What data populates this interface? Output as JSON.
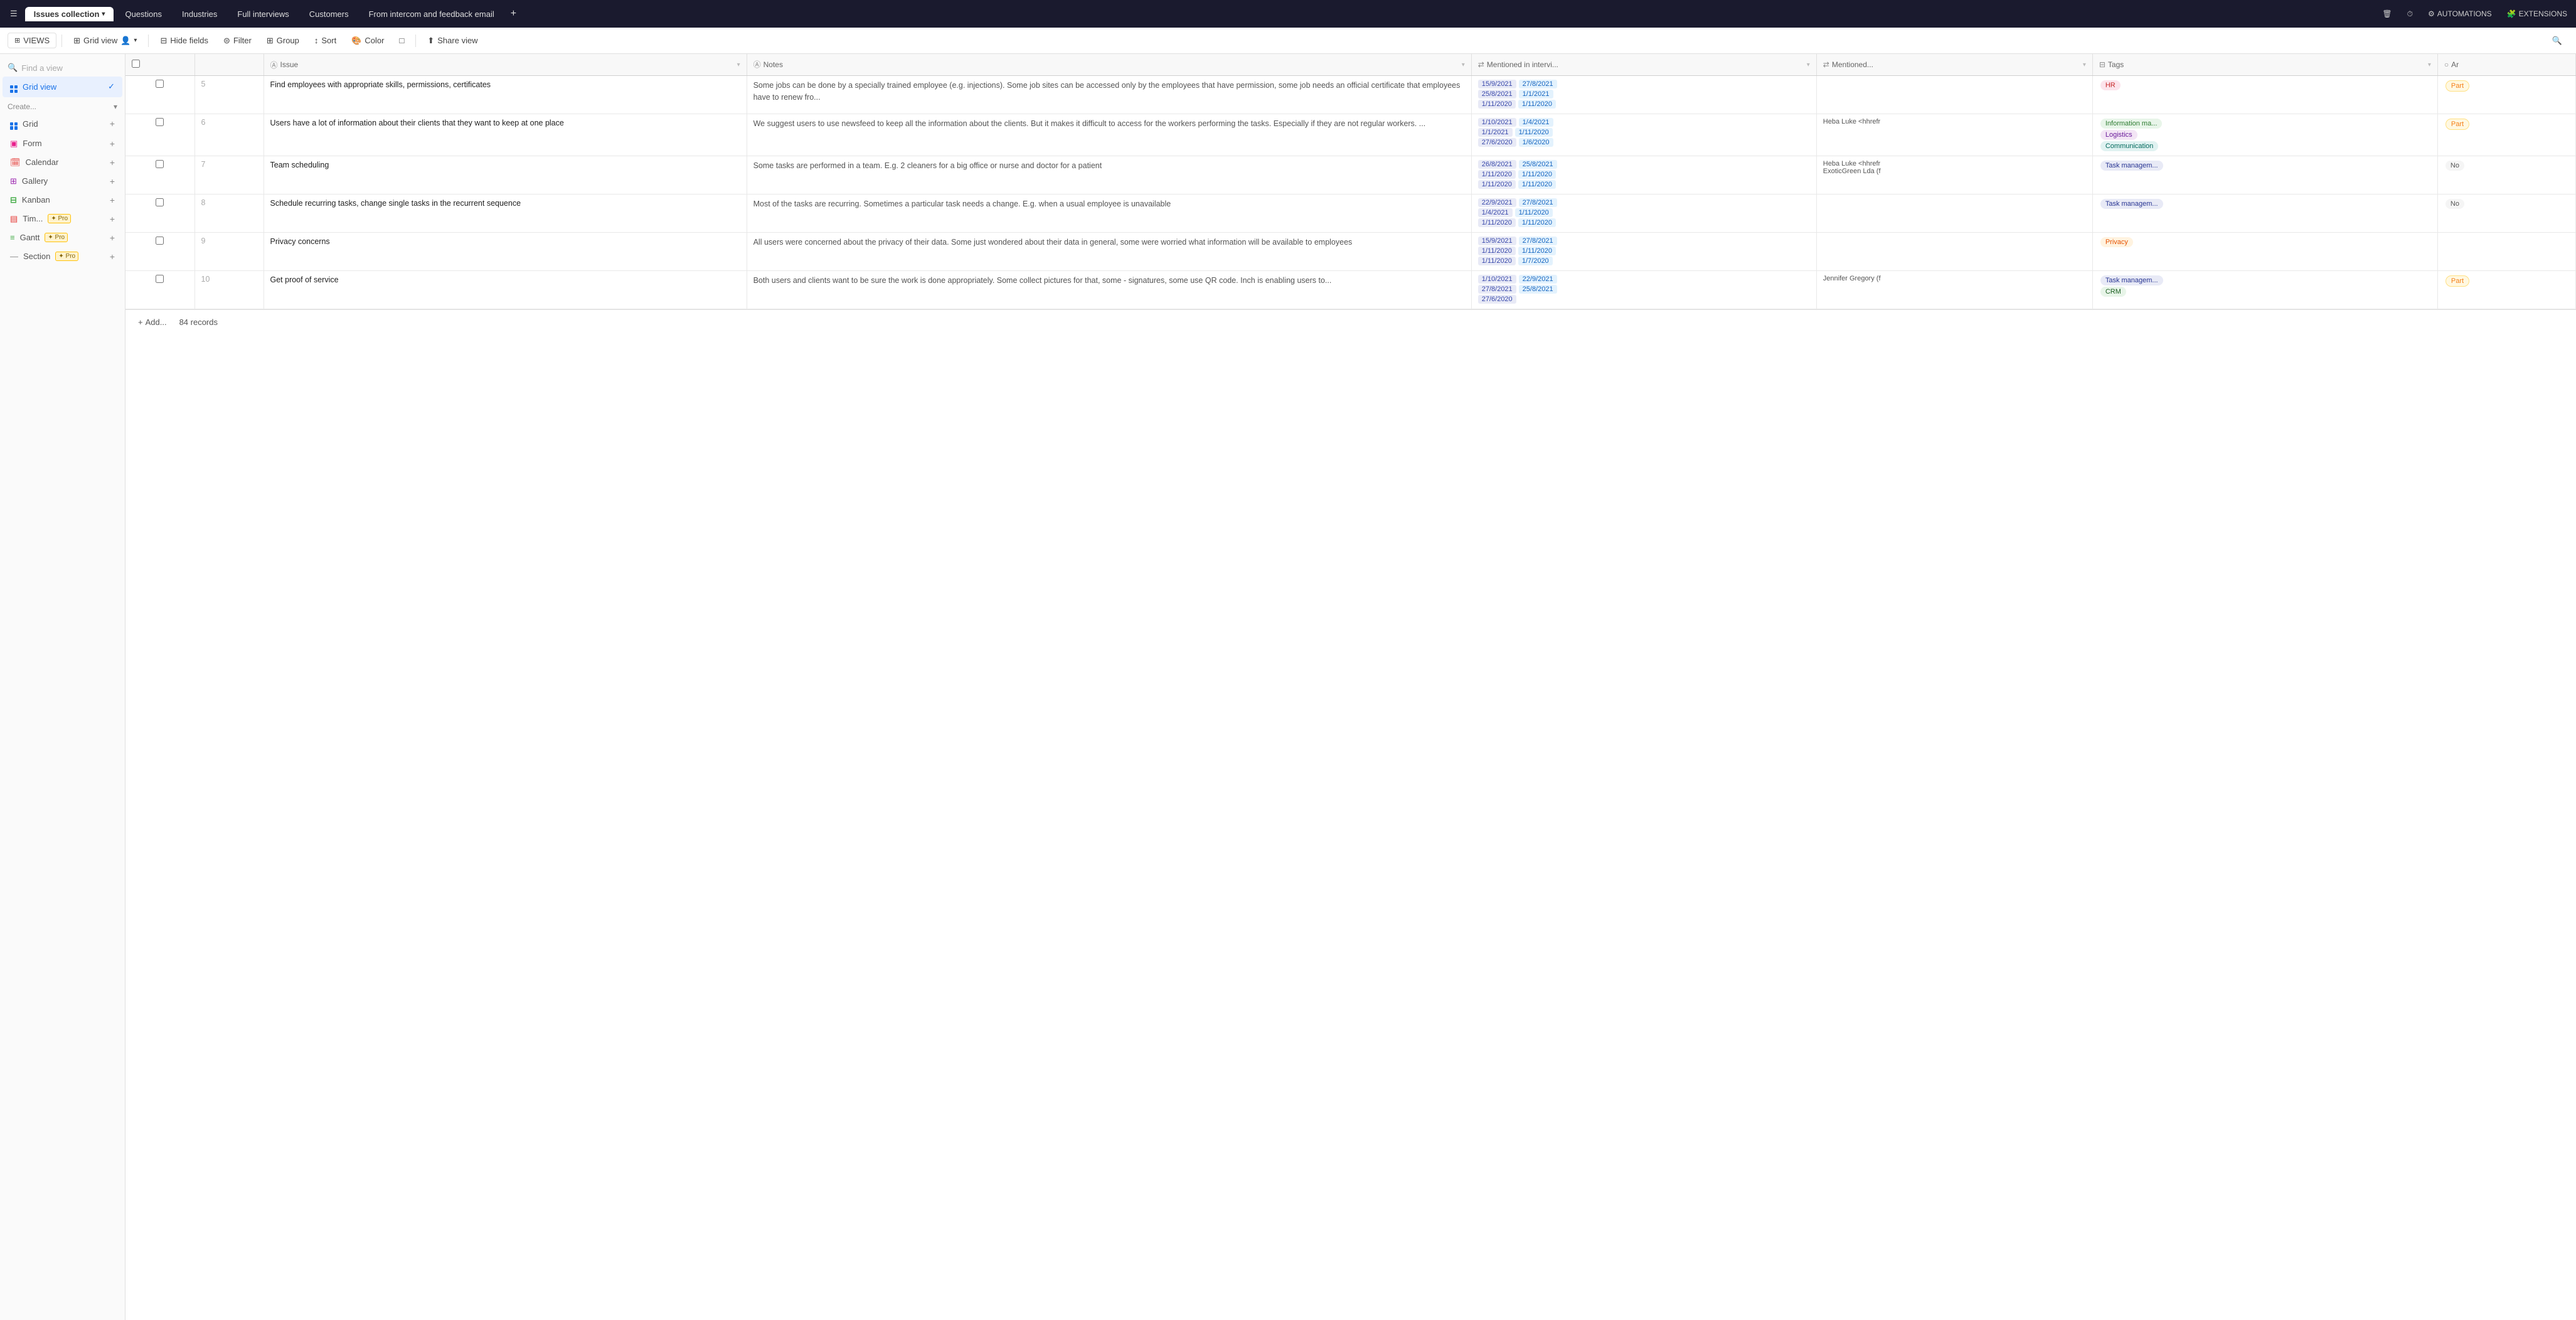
{
  "topNav": {
    "hamburger": "☰",
    "activeTab": "Issues collection",
    "tabs": [
      {
        "id": "issues",
        "label": "Issues collection",
        "active": true,
        "hasDropdown": true
      },
      {
        "id": "questions",
        "label": "Questions",
        "active": false
      },
      {
        "id": "industries",
        "label": "Industries",
        "active": false
      },
      {
        "id": "fullInterviews",
        "label": "Full interviews",
        "active": false
      },
      {
        "id": "customers",
        "label": "Customers",
        "active": false
      },
      {
        "id": "fromIntercom",
        "label": "From intercom and feedback email",
        "active": false
      }
    ],
    "addTabIcon": "+",
    "actions": [
      {
        "id": "trash",
        "icon": "🗑",
        "label": ""
      },
      {
        "id": "history",
        "icon": "⏱",
        "label": ""
      },
      {
        "id": "automations",
        "icon": "⚙",
        "label": "AUTOMATIONS"
      },
      {
        "id": "extensions",
        "icon": "🧩",
        "label": "EXTENSIONS"
      }
    ]
  },
  "toolbar": {
    "views": "VIEWS",
    "gridView": "Grid view",
    "hideFields": "Hide fields",
    "filter": "Filter",
    "group": "Group",
    "sort": "Sort",
    "color": "Color",
    "shareView": "Share view",
    "searchIcon": "🔍"
  },
  "sidebar": {
    "searchPlaceholder": "Find a view",
    "views": [
      {
        "id": "grid",
        "label": "Grid view",
        "active": true,
        "icon": "grid"
      }
    ],
    "createLabel": "Create...",
    "createItems": [
      {
        "id": "grid",
        "label": "Grid",
        "icon": "grid",
        "pro": false
      },
      {
        "id": "form",
        "label": "Form",
        "icon": "form",
        "pro": false
      },
      {
        "id": "calendar",
        "label": "Calendar",
        "icon": "calendar",
        "pro": false
      },
      {
        "id": "gallery",
        "label": "Gallery",
        "icon": "gallery",
        "pro": false
      },
      {
        "id": "kanban",
        "label": "Kanban",
        "icon": "kanban",
        "pro": false
      },
      {
        "id": "timeline",
        "label": "Tim...",
        "icon": "timeline",
        "pro": true
      },
      {
        "id": "gantt",
        "label": "Gantt",
        "icon": "gantt",
        "pro": true
      },
      {
        "id": "section",
        "label": "Section",
        "icon": "section",
        "pro": true
      }
    ]
  },
  "table": {
    "columns": [
      {
        "id": "checkbox",
        "label": "",
        "icon": "checkbox"
      },
      {
        "id": "issue",
        "label": "Issue",
        "icon": "text"
      },
      {
        "id": "notes",
        "label": "Notes",
        "icon": "text"
      },
      {
        "id": "mentioned1",
        "label": "Mentioned in intervi...",
        "icon": "link"
      },
      {
        "id": "mentioned2",
        "label": "Mentioned...",
        "icon": "link"
      },
      {
        "id": "tags",
        "label": "Tags",
        "icon": "tag"
      },
      {
        "id": "ar",
        "label": "Ar",
        "icon": "circle"
      }
    ],
    "rows": [
      {
        "id": 5,
        "issue": "Find employees with appropriate skills, permissions, certificates",
        "notes": "Some jobs can be done by a specially trained employee (e.g. injections). Some job sites can be accessed only by the employees that have permission, some job needs an official certificate that employees have to renew fro...",
        "mentioned1Dates": [
          [
            "15/9/2021",
            "27/8/2021"
          ],
          [
            "25/8/2021",
            "1/1/2021"
          ],
          [
            "1/11/2020",
            "1/11/2020"
          ]
        ],
        "mentioned2": [],
        "tags": [
          {
            "label": "HR",
            "class": "tag-hr"
          }
        ],
        "ar": [
          {
            "label": "Part",
            "class": "tag-part"
          }
        ]
      },
      {
        "id": 6,
        "issue": "Users have a lot of information about their clients that they want to keep at one place",
        "notes": "We suggest users to use newsfeed to keep all the information about the clients. But it makes it difficult to access for the workers performing the tasks. Especially if they are not regular workers. ...",
        "mentioned1Dates": [
          [
            "1/10/2021",
            "1/4/2021"
          ],
          [
            "1/1/2021",
            "1/11/2020"
          ],
          [
            "27/6/2020",
            "1/6/2020"
          ]
        ],
        "mentioned2": [
          {
            "label": "Heba Luke <hhrefr",
            "class": "person-chip"
          }
        ],
        "tags": [
          {
            "label": "Information ma...",
            "class": "tag-info"
          },
          {
            "label": "Logistics",
            "class": "tag-logistics"
          },
          {
            "label": "Communication",
            "class": "tag-communication"
          }
        ],
        "ar": [
          {
            "label": "Part",
            "class": "tag-part"
          }
        ]
      },
      {
        "id": 7,
        "issue": "Team scheduling",
        "notes": "Some tasks are performed in a team. E.g. 2 cleaners for a big office or nurse and doctor for a patient",
        "mentioned1Dates": [
          [
            "26/8/2021",
            "25/8/2021"
          ],
          [
            "1/11/2020",
            "1/11/2020"
          ],
          [
            "1/11/2020",
            "1/11/2020"
          ]
        ],
        "mentioned2": [
          {
            "label": "Heba Luke <hhrefr",
            "class": "person-chip"
          },
          {
            "label": "ExoticGreen Lda (f",
            "class": "person-chip"
          }
        ],
        "tags": [
          {
            "label": "Task managem...",
            "class": "tag-task"
          }
        ],
        "ar": [
          {
            "label": "No",
            "class": "tag-no"
          }
        ]
      },
      {
        "id": 8,
        "issue": "Schedule recurring tasks, change single tasks in the recurrent sequence",
        "notes": "Most of the tasks are recurring. Sometimes a particular task needs a change. E.g. when a usual employee is unavailable",
        "mentioned1Dates": [
          [
            "22/9/2021",
            "27/8/2021"
          ],
          [
            "1/4/2021",
            "1/11/2020"
          ],
          [
            "1/11/2020",
            "1/11/2020"
          ]
        ],
        "mentioned2": [],
        "tags": [
          {
            "label": "Task managem...",
            "class": "tag-task"
          }
        ],
        "ar": [
          {
            "label": "No",
            "class": "tag-no"
          }
        ]
      },
      {
        "id": 9,
        "issue": "Privacy concerns",
        "notes": "All users were concerned about the privacy of their data. Some just wondered about their data in general, some were worried what information will be available to employees",
        "mentioned1Dates": [
          [
            "15/9/2021",
            "27/8/2021"
          ],
          [
            "1/11/2020",
            "1/11/2020"
          ],
          [
            "1/11/2020",
            "1/7/2020"
          ]
        ],
        "mentioned2": [],
        "tags": [
          {
            "label": "Privacy",
            "class": "tag-privacy"
          }
        ],
        "ar": []
      },
      {
        "id": 10,
        "issue": "Get proof of service",
        "notes": "Both users and clients want to be sure the work is done appropriately. Some collect pictures for that, some - signatures, some use QR code. Inch is enabling users to...",
        "mentioned1Dates": [
          [
            "1/10/2021",
            "22/9/2021"
          ],
          [
            "27/8/2021",
            "25/8/2021"
          ],
          [
            "27/6/2020",
            ""
          ]
        ],
        "mentioned2": [
          {
            "label": "Jennifer Gregory (f",
            "class": "person-chip"
          }
        ],
        "tags": [
          {
            "label": "Task managem...",
            "class": "tag-task"
          },
          {
            "label": "CRM",
            "class": "tag-crm"
          }
        ],
        "ar": [
          {
            "label": "Part",
            "class": "tag-part"
          }
        ]
      }
    ],
    "footer": {
      "addLabel": "Add...",
      "recordCount": "84 records"
    }
  }
}
